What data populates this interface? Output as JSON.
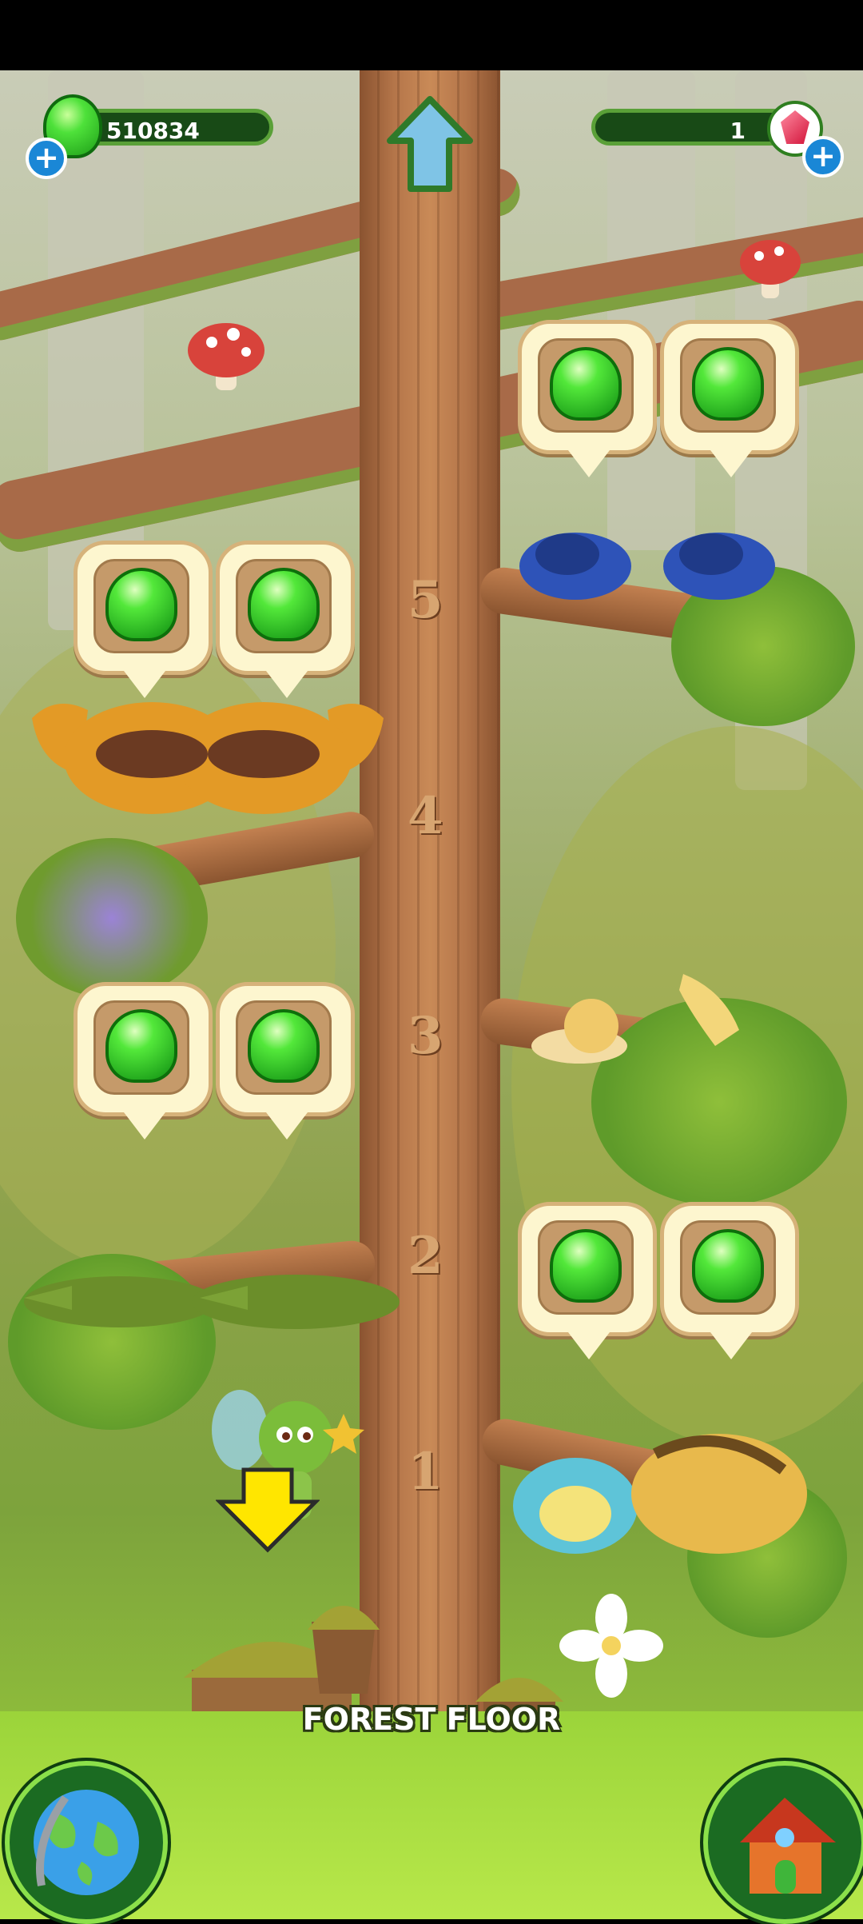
{
  "hud": {
    "jelly_count": "510834",
    "crystal_count": "1",
    "jelly_icon": "green-jelly-icon",
    "crystal_icon": "red-crystal-icon",
    "add_jelly_icon": "plus-icon",
    "add_crystal_icon": "plus-icon",
    "plus_glyph": "+",
    "up_button_icon": "up-arrow-icon"
  },
  "tree": {
    "levels": [
      "5",
      "4",
      "3",
      "2",
      "1"
    ],
    "floor_label": "FOREST FLOOR"
  },
  "nav": {
    "world_button_icon": "globe-icon",
    "home_button_icon": "house-icon",
    "down_arrow_icon": "down-arrow-icon"
  },
  "colors": {
    "jelly_green": "#3ee33a",
    "hud_bg": "#184a16",
    "trunk": "#b5764a"
  }
}
